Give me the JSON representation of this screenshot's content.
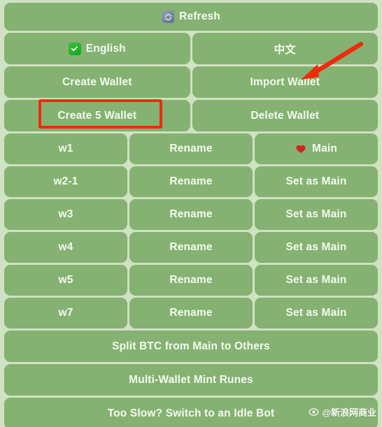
{
  "colors": {
    "page_background": "#cfe2c1",
    "button_background": "#85b272",
    "button_text": "#f3fbef",
    "annotation_red": "#ef2b0c",
    "check_green": "#17a41c",
    "refresh_blue_gray": "#5e7389",
    "heart_red": "#d61f26"
  },
  "toolbar": {
    "refresh_label": "Refresh",
    "refresh_icon": "refresh-icon"
  },
  "language": {
    "english_label": "English",
    "english_icon": "check-icon",
    "chinese_label": "中文"
  },
  "wallet_actions": {
    "create_wallet": "Create Wallet",
    "import_wallet": "Import Wallet",
    "create_5_wallet": "Create 5 Wallet",
    "delete_wallet": "Delete Wallet"
  },
  "wallet_list": {
    "rename_label": "Rename",
    "set_as_main_label": "Set as Main",
    "main_label": "Main",
    "main_icon": "heart-icon",
    "rows": [
      {
        "name": "w1",
        "action": "Rename",
        "status": "Main",
        "is_main": true
      },
      {
        "name": "w2-1",
        "action": "Rename",
        "status": "Set as Main",
        "is_main": false
      },
      {
        "name": "w3",
        "action": "Rename",
        "status": "Set as Main",
        "is_main": false
      },
      {
        "name": "w4",
        "action": "Rename",
        "status": "Set as Main",
        "is_main": false
      },
      {
        "name": "w5",
        "action": "Rename",
        "status": "Set as Main",
        "is_main": false
      },
      {
        "name": "w7",
        "action": "Rename",
        "status": "Set as Main",
        "is_main": false
      }
    ]
  },
  "bottom_actions": [
    {
      "label": "Split BTC from Main to Others"
    },
    {
      "label": "Multi-Wallet Mint Runes"
    },
    {
      "label": "Too Slow? Switch to an Idle Bot"
    }
  ],
  "annotations": {
    "highlight_target": "create-5-wallet-button",
    "arrow_target": "import-wallet-button"
  },
  "watermark": {
    "text": "@新浪网商业",
    "logo": "sina-weibo-eye-icon"
  }
}
